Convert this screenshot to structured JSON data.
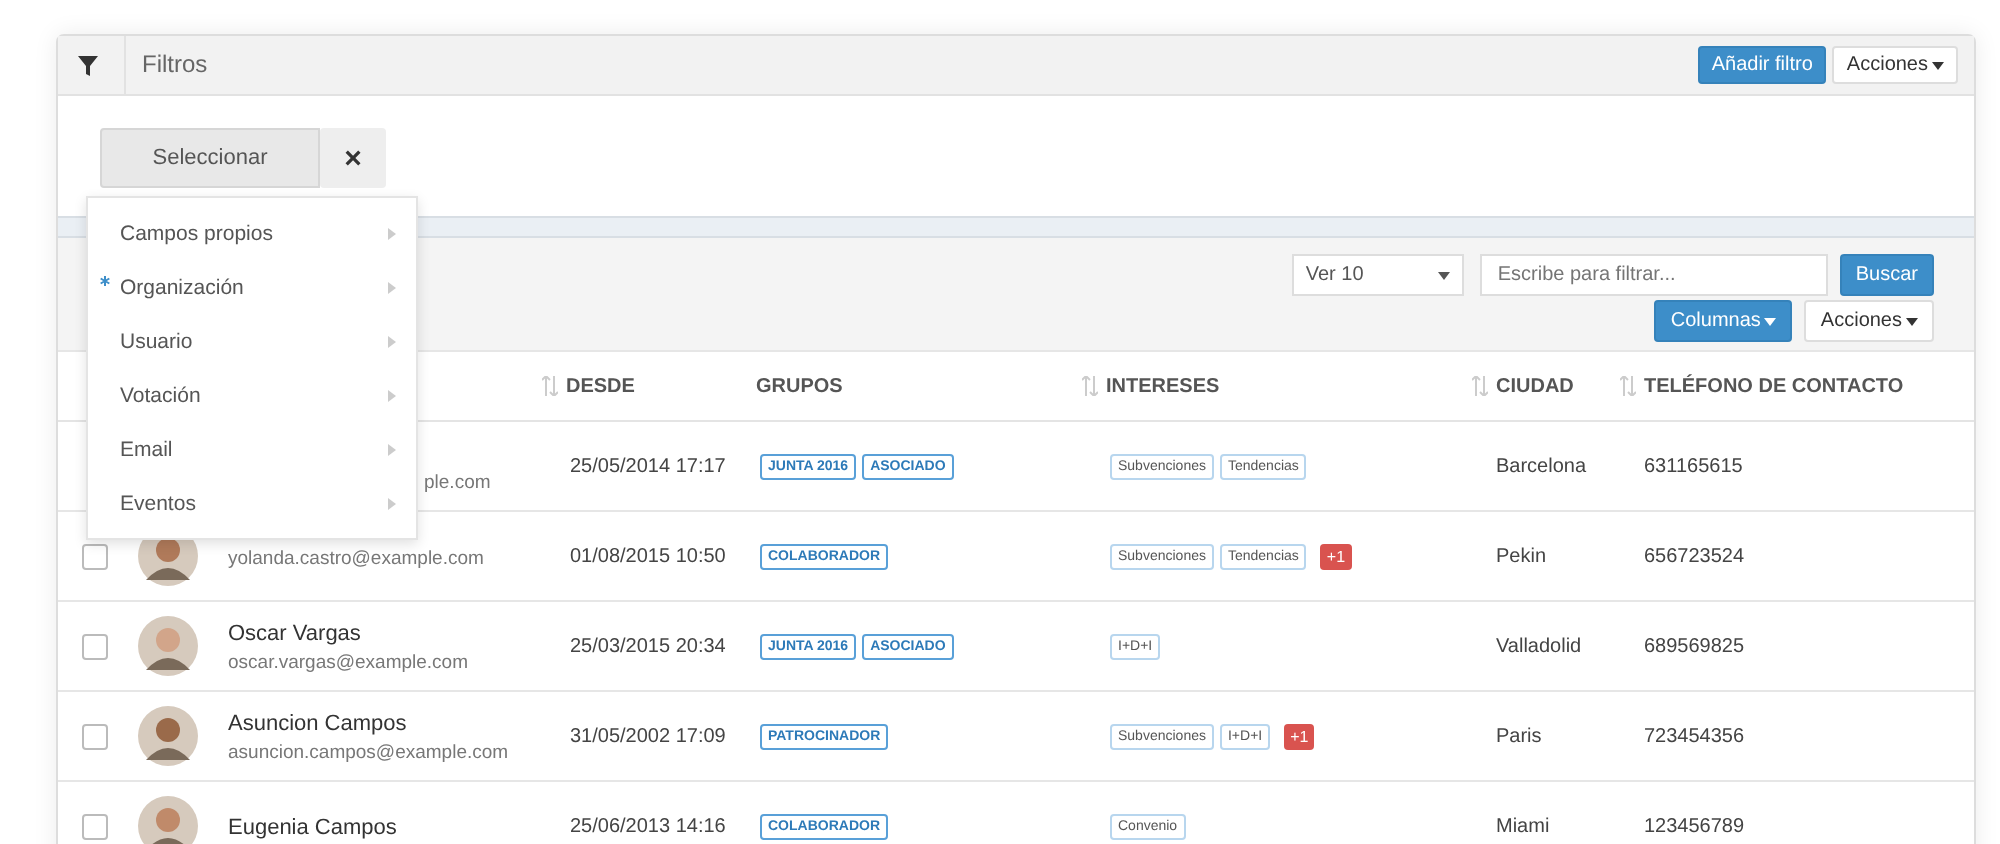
{
  "filter_panel": {
    "title": "Filtros",
    "add_button": "Añadir filtro",
    "actions_button": "Acciones",
    "select_button": "Seleccionar",
    "clear_button": "×"
  },
  "filter_menu": [
    {
      "label": "Campos propios",
      "marked": false
    },
    {
      "label": "Organización",
      "marked": true
    },
    {
      "label": "Usuario",
      "marked": false
    },
    {
      "label": "Votación",
      "marked": false
    },
    {
      "label": "Email",
      "marked": false
    },
    {
      "label": "Eventos",
      "marked": false
    }
  ],
  "toolbar": {
    "page_size": "Ver 10",
    "search": {
      "placeholder": "Escribe para filtrar..."
    },
    "search_button": "Buscar",
    "columns_button": "Columnas",
    "actions_button": "Acciones"
  },
  "table": {
    "columns": [
      {
        "label": "DESDE",
        "sortable": true
      },
      {
        "label": "GRUPOS",
        "sortable": false
      },
      {
        "label": "INTERESES",
        "sortable": true
      },
      {
        "label": "CIUDAD",
        "sortable": true
      },
      {
        "label": "TELÉFONO DE CONTACTO",
        "sortable": true
      }
    ],
    "rows": [
      {
        "email": "ple.com",
        "date": "25/05/2014 17:17",
        "groups": [
          "JUNTA 2016",
          "ASOCIADO"
        ],
        "interests": [
          "Subvenciones",
          "Tendencias"
        ],
        "city": "Barcelona",
        "phone": "631165615"
      },
      {
        "checked": false,
        "email": "yolanda.castro@example.com",
        "date": "01/08/2015 10:50",
        "groups": [
          "COLABORADOR"
        ],
        "interests": [
          "Subvenciones",
          "Tendencias"
        ],
        "more": "+1",
        "city": "Pekin",
        "phone": "656723524"
      },
      {
        "checked": false,
        "name": "Oscar Vargas",
        "email": "oscar.vargas@example.com",
        "date": "25/03/2015 20:34",
        "groups": [
          "JUNTA 2016",
          "ASOCIADO"
        ],
        "interests": [
          "I+D+I"
        ],
        "city": "Valladolid",
        "phone": "689569825"
      },
      {
        "checked": false,
        "name": "Asuncion Campos",
        "email": "asuncion.campos@example.com",
        "date": "31/05/2002 17:09",
        "groups": [
          "PATROCINADOR"
        ],
        "interests": [
          "Subvenciones",
          "I+D+I"
        ],
        "more": "+1",
        "city": "Paris",
        "phone": "723454356"
      },
      {
        "checked": false,
        "name": "Eugenia Campos",
        "date": "25/06/2013 14:16",
        "groups": [
          "COLABORADOR"
        ],
        "interests": [
          "Convenio"
        ],
        "city": "Miami",
        "phone": "123456789"
      }
    ]
  }
}
